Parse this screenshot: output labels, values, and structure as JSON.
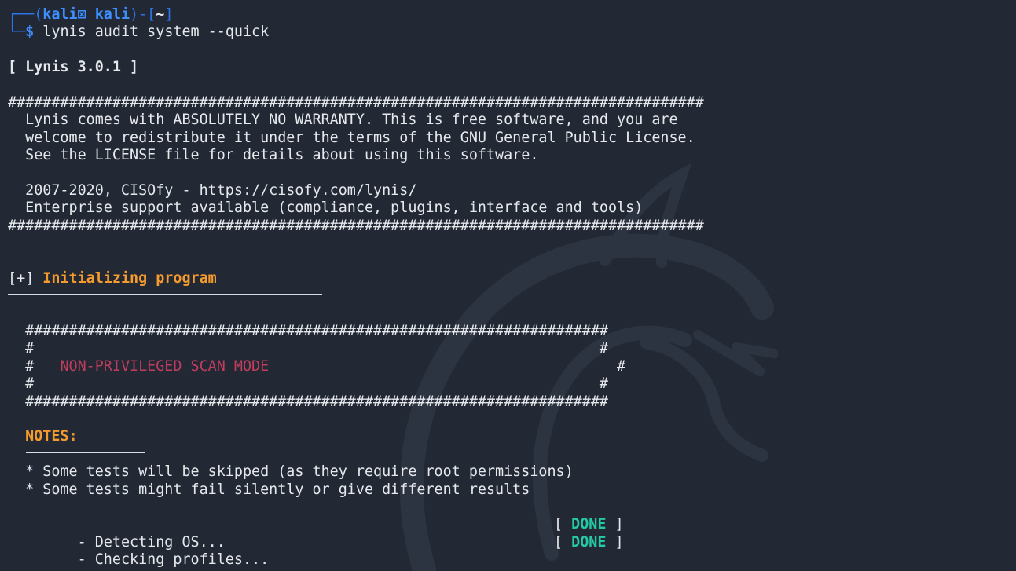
{
  "terminal": {
    "prompt": {
      "frame_top": "┌──(",
      "user_host": "kali⊠ kali",
      "path_open": ")-[",
      "path": "~",
      "path_close": "]",
      "frame_bottom": "└─",
      "dollar": "$",
      "command": " lynis audit system --quick"
    },
    "version_banner": "[ Lynis 3.0.1 ]",
    "hash_line_long": "################################################################################",
    "license_lines": [
      "  Lynis comes with ABSOLUTELY NO WARRANTY. This is free software, and you are",
      "  welcome to redistribute it under the terms of the GNU General Public License.",
      "  See the LICENSE file for details about using this software.",
      "",
      "  2007-2020, CISOfy - https://cisofy.com/lynis/",
      "  Enterprise support available (compliance, plugins, interface and tools)"
    ],
    "section_prefix": "[+] ",
    "section_title": "Initializing program",
    "mode_box": {
      "top": "  ###################################################################",
      "empty": "  #                                                                 #",
      "middle_prefix": "  #   ",
      "label": "NON-PRIVILEGED SCAN MODE",
      "middle_suffix": "                                        #",
      "bottom": "  ###################################################################"
    },
    "notes_label": "  NOTES:",
    "notes": [
      "  * Some tests will be skipped (as they require root permissions)",
      "  * Some tests might fail silently or give different results"
    ],
    "checks": [
      {
        "label": "  - Detecting OS...",
        "open": "[ ",
        "status": "DONE",
        "close": " ]"
      },
      {
        "label": "  - Checking profiles...",
        "open": "[ ",
        "status": "DONE",
        "close": " ]"
      }
    ]
  },
  "colors": {
    "background": "#222935",
    "prompt_blue": "#3d8eff",
    "orange": "#f59a2d",
    "red": "#c13c5d",
    "teal": "#24c9a6",
    "text": "#e6e8ec"
  },
  "icons": {
    "watermark": "kali-dragon-watermark"
  }
}
